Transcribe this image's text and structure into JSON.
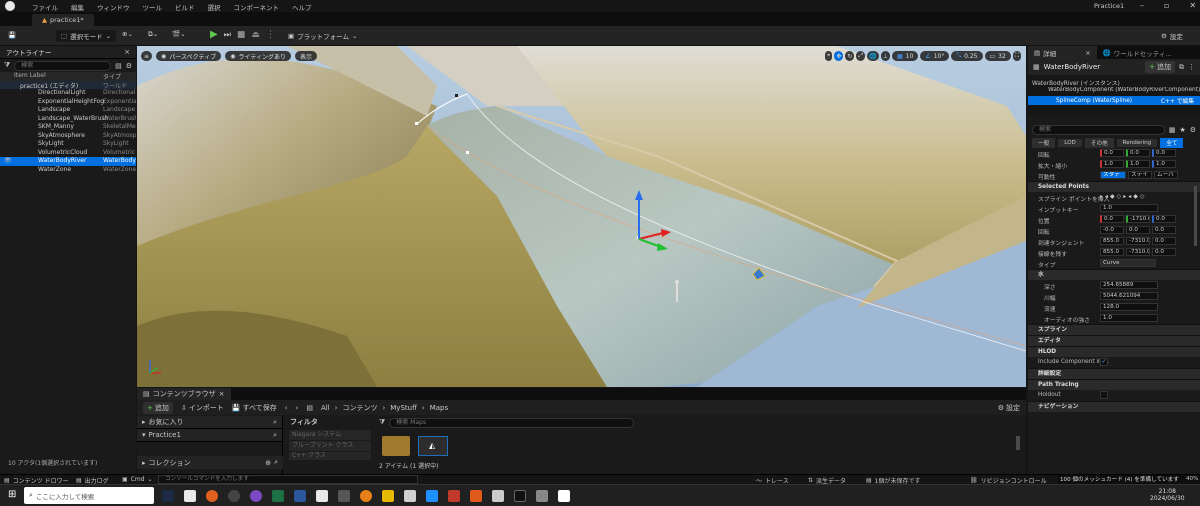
{
  "menubar": {
    "items": [
      "ファイル",
      "編集",
      "ウィンドウ",
      "ツール",
      "ビルド",
      "選択",
      "コンポーネント",
      "ヘルプ"
    ],
    "project": "Practice1"
  },
  "tab": {
    "label": "practice1*"
  },
  "toolbar": {
    "save": "",
    "mode": "選択モード",
    "platform": "プラットフォーム",
    "settings": "設定"
  },
  "outliner": {
    "title": "アウトライナー",
    "search_placeholder": "検索",
    "col_label": "Item Label",
    "col_type": "タイプ",
    "root": {
      "name": "practice1 (エディタ)",
      "type": "ワールド"
    },
    "items": [
      {
        "name": "DirectionalLight",
        "type": "DirectionalLi"
      },
      {
        "name": "ExponentialHeightFog",
        "type": "Exponential"
      },
      {
        "name": "Landscape",
        "type": "Landscape"
      },
      {
        "name": "Landscape_WaterBrush",
        "type": "WaterBrush"
      },
      {
        "name": "SKM_Manny",
        "type": "SkeletalMe"
      },
      {
        "name": "SkyAtmosphere",
        "type": "SkyAtmosph"
      },
      {
        "name": "SkyLight",
        "type": "SkyLight"
      },
      {
        "name": "VolumetricCloud",
        "type": "Volumetric"
      },
      {
        "name": "WaterBodyRiver",
        "type": "WaterBody"
      },
      {
        "name": "WaterZone",
        "type": "WaterZone"
      }
    ],
    "status": "10 アクタ(1個選択されています)"
  },
  "viewport": {
    "perspective": "パースペクティブ",
    "lighting": "ライティングあり",
    "show": "表示",
    "grid": "10",
    "angle": "10°",
    "scale": "0.25",
    "speed": "32"
  },
  "details": {
    "tab1": "詳細",
    "tab2": "ワールドセッティ...",
    "actor": "WaterBodyRiver",
    "add": "追加",
    "instance": "WaterBodyRiver (インスタンス)",
    "component": "WaterBodyComponent (WaterBodyRiverComponent)",
    "spline": "SplineComp (WaterSpline)",
    "cpp": "C++ で編集",
    "search_placeholder": "検索",
    "filters": [
      "一般",
      "LOD",
      "その他",
      "Rendering",
      "全て"
    ],
    "rot_label": "回転",
    "rot": [
      "0.0",
      "0.0",
      "0.0"
    ],
    "scale_label": "拡大・縮小",
    "scale": [
      "1.0",
      "1.0",
      "1.0"
    ],
    "mobility_label": "可動性",
    "mobility": [
      "スタティック",
      "ステイシ",
      "ムーバブ"
    ],
    "sec_selected": "Selected Points",
    "spline_point": "スプライン ポイントを挿入",
    "input_key": "インプットキー",
    "input_key_val": "1.0",
    "pos_label": "位置",
    "pos": [
      "0.0",
      "-1710.0",
      "0.0"
    ],
    "rot2_label": "回転",
    "rot2": [
      "-0.0",
      "0.0",
      "0.0"
    ],
    "arrive_label": "到達タンジェント",
    "arrive": [
      "855.0",
      "-7310.0",
      "0.0"
    ],
    "leave_label": "接線を残す",
    "leave": [
      "855.0",
      "-7310.0",
      "0.0"
    ],
    "type_label": "タイプ",
    "type_val": "Curve",
    "sec_water": "水",
    "depth_label": "深さ",
    "depth": "254.65889",
    "width_label": "川幅",
    "width": "5044.621094",
    "velocity_label": "流速",
    "velocity": "128.0",
    "audio_label": "オーディオの強さ",
    "audio": "1.0",
    "sec_spline": "スプライン",
    "sec_editor": "エディタ",
    "sec_hlod": "HLOD",
    "hlod_label": "Include Component in ...",
    "sec_detail": "詳細設定",
    "sec_path": "Path Tracing",
    "holdout": "Holdout",
    "sec_nav": "ナビゲーション"
  },
  "content": {
    "tab": "コンテンツブラウザ",
    "add": "追加",
    "import": "インポート",
    "saveall": "すべて保存",
    "breadcrumb": [
      "All",
      "コンテンツ",
      "MyStuff",
      "Maps"
    ],
    "settings": "設定",
    "favorites": "お気に入り",
    "practice": "Practice1",
    "collection": "コレクション",
    "filter": "フィルタ",
    "filters": [
      "Niagara システム",
      "ブループリント クラス",
      "C++ クラス"
    ],
    "search_placeholder": "検索 Maps",
    "status": "2 アイテム (1 選択中)"
  },
  "statusbar": {
    "drawer": "コンテンツ ドロワー",
    "log": "出力ログ",
    "cmd": "Cmd",
    "cmd_placeholder": "コンソールコマンドを入力します",
    "trace": "トレース",
    "derived": "派生データ",
    "unsaved": "1個が未保存です",
    "revision": "リビジョンコントロール",
    "progress_text": "100 個のメッシュカード (4) を準備しています",
    "progress_pct": "40%"
  },
  "taskbar": {
    "search_placeholder": "ここに入力して検索",
    "time": "21:08",
    "date": "2024/06/30"
  }
}
